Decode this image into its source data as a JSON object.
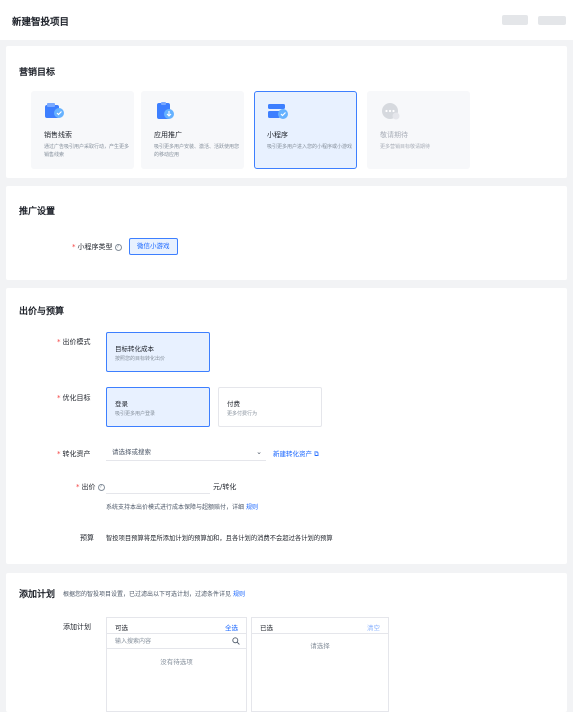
{
  "header": {
    "title": "新建智投项目"
  },
  "marketing": {
    "title": "营销目标",
    "goals": [
      {
        "name": "销售线索",
        "desc": "通过广告吸引用户采取行动，产生更多销售线索"
      },
      {
        "name": "应用推广",
        "desc": "吸引更多用户安装、激活、活跃使用您的移动应用"
      },
      {
        "name": "小程序",
        "desc": "吸引更多用户进入您的小程序或小游戏"
      },
      {
        "name": "敬请期待",
        "desc": "更多营销目标敬请期待"
      }
    ]
  },
  "promotion": {
    "title": "推广设置",
    "type_label": "小程序类型",
    "type_value": "微信小游戏"
  },
  "bidding": {
    "title": "出价与预算",
    "mode_label": "出价模式",
    "mode_option": {
      "name": "目标转化成本",
      "desc": "按照您的目标转化出价"
    },
    "goal_label": "优化目标",
    "goal_options": [
      {
        "name": "登录",
        "desc": "吸引更多用户登录"
      },
      {
        "name": "付费",
        "desc": "更多付费行为"
      }
    ],
    "asset_label": "转化资产",
    "asset_placeholder": "请选择或搜索",
    "asset_new_link": "新建转化资产",
    "bid_label": "出价",
    "bid_unit": "元/转化",
    "bid_note": "系统支持本出价模式进行成本保障与超额赔付，详细",
    "bid_note_link": "规则",
    "budget_label": "预算",
    "budget_text": "智投项目预算将是所添加计划的预算加和，且各计划的消费不会超过各计划的预算"
  },
  "plans": {
    "title": "添加计划",
    "subtitle": "根据您的智投项目设置，已过滤出以下可选计划，过滤条件详见",
    "subtitle_link": "规则",
    "field_label": "添加计划",
    "available_title": "可选",
    "select_all": "全选",
    "search_placeholder": "输入搜索内容",
    "empty_text": "没有待选项",
    "selected_title": "已选",
    "clear": "清空",
    "selected_placeholder": "请选择"
  }
}
